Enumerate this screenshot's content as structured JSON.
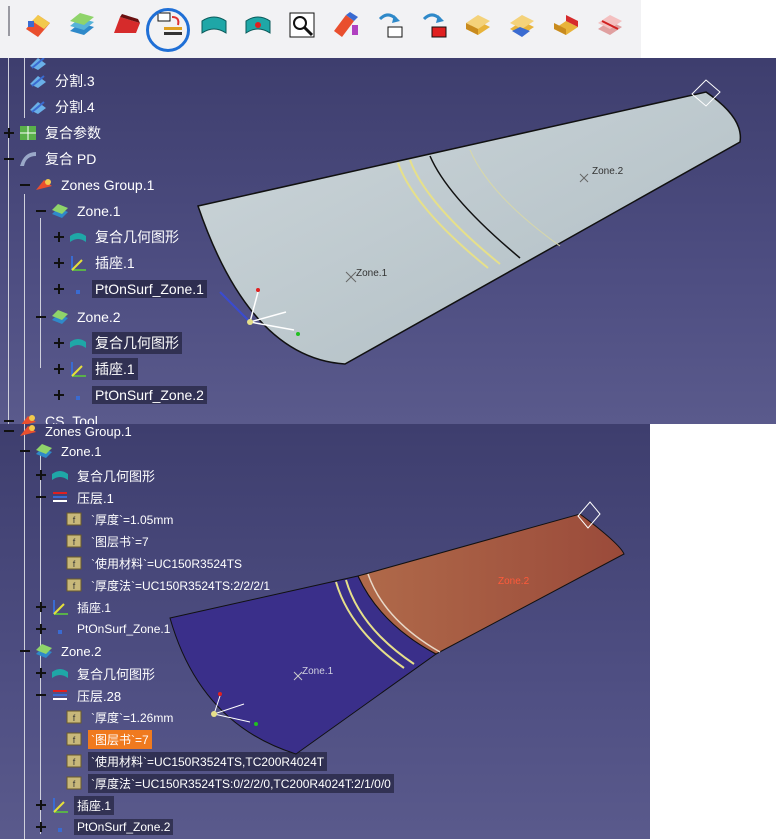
{
  "toolbar": {
    "icons": [
      "composite-part-icon",
      "layer-stack-icon",
      "red-solid-icon",
      "ply-split-icon",
      "surface-green-icon",
      "surface-red-dot-icon",
      "inspect-icon",
      "multi-color-icon",
      "transfer-red-icon",
      "transfer-red-fill-icon",
      "solid-yellow-icon",
      "solid-multi-icon",
      "solid-red-icon",
      "solid-stripe-icon"
    ]
  },
  "top_tree": {
    "split3": "分割.3",
    "split4": "分割.4",
    "composite_params": "复合参数",
    "composite_pd": "复合 PD",
    "zones_group": "Zones Group.1",
    "zone1": "Zone.1",
    "zone1_geom": "复合几何图形",
    "zone1_socket": "插座.1",
    "zone1_pt": "PtOnSurf_Zone.1",
    "zone2": "Zone.2",
    "zone2_geom": "复合几何图形",
    "zone2_socket": "插座.1",
    "zone2_pt": "PtOnSurf_Zone.2",
    "cs_tool": "CS_Tool"
  },
  "top_view": {
    "zone1_label": "Zone.1",
    "zone2_label": "Zone.2"
  },
  "bottom_tree": {
    "zones_group": "Zones Group.1",
    "zone1": "Zone.1",
    "zone1_geom": "复合几何图形",
    "zone1_layer": "压层.1",
    "zone1_thickness": "`厚度`=1.05mm",
    "zone1_plies": "`图层书`=7",
    "zone1_material": "`使用材料`=UC150R3524TS",
    "zone1_method": "`厚度法`=UC150R3524TS:2/2/2/1",
    "zone1_socket": "插座.1",
    "zone1_pt": "PtOnSurf_Zone.1",
    "zone2": "Zone.2",
    "zone2_geom": "复合几何图形",
    "zone2_layer": "压层.28",
    "zone2_thickness": "`厚度`=1.26mm",
    "zone2_plies": "`图层书`=7",
    "zone2_material": "`使用材料`=UC150R3524TS,TC200R4024T",
    "zone2_method": "`厚度法`=UC150R3524TS:0/2/2/0,TC200R4024T:2/1/0/0",
    "zone2_socket": "插座.1",
    "zone2_pt": "PtOnSurf_Zone.2"
  },
  "bottom_view": {
    "zone1_label": "Zone.1",
    "zone2_label": "Zone.2"
  },
  "colors": {
    "selection": "#f07a1e",
    "highlight_ring": "#1f6fd6",
    "background": "#4a4a7c"
  }
}
